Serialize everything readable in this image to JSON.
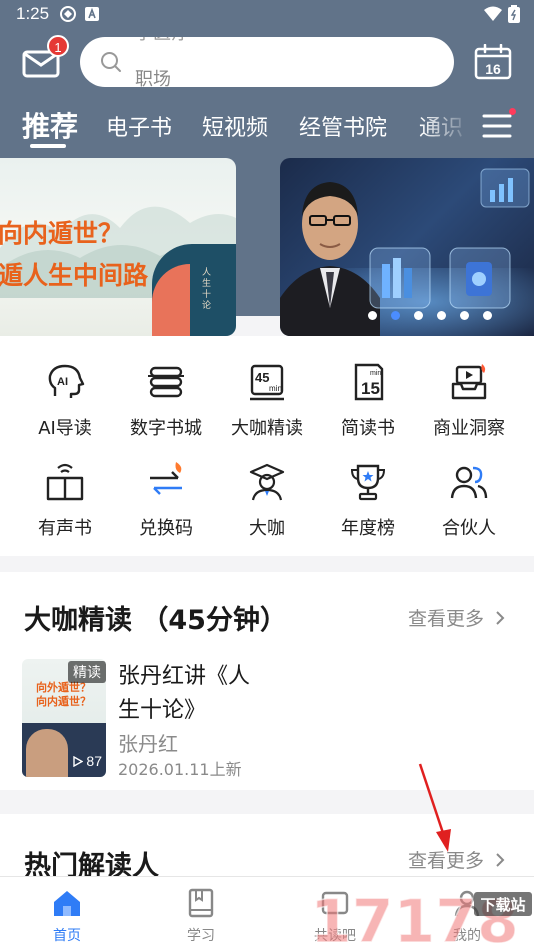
{
  "status_bar": {
    "time": "1:25"
  },
  "header": {
    "mail_badge": "1",
    "search": {
      "ghost_text": "学医疗",
      "placeholder": "职场"
    },
    "calendar_day": "16"
  },
  "tabs": [
    {
      "label": "推荐",
      "active": true
    },
    {
      "label": "电子书",
      "active": false
    },
    {
      "label": "短视频",
      "active": false
    },
    {
      "label": "经管书院",
      "active": false
    },
    {
      "label": "通识",
      "active": false
    }
  ],
  "banner": {
    "left_line1": "向内遁世？",
    "left_line2": "遁人生中间路",
    "left_book_text": "人生十论",
    "dots_count": 6,
    "active_dot": 1
  },
  "quick_menu": [
    {
      "label": "AI导读",
      "icon": "ai-head-icon"
    },
    {
      "label": "数字书城",
      "icon": "book-stack-icon"
    },
    {
      "label": "大咖精读",
      "icon": "45min-icon"
    },
    {
      "label": "简读书",
      "icon": "15min-icon"
    },
    {
      "label": "商业洞察",
      "icon": "inbox-play-icon"
    },
    {
      "label": "有声书",
      "icon": "audio-book-icon"
    },
    {
      "label": "兑换码",
      "icon": "exchange-icon"
    },
    {
      "label": "大咖",
      "icon": "graduate-icon"
    },
    {
      "label": "年度榜",
      "icon": "trophy-icon"
    },
    {
      "label": "合伙人",
      "icon": "partners-icon"
    }
  ],
  "section_experts": {
    "title": "大咖精读 （45分钟）",
    "see_more": "查看更多",
    "card": {
      "tag": "精读",
      "cover_line1": "向外遁世？",
      "cover_line2": "向内遁世？",
      "plays": "87",
      "title": "张丹红讲《人生十论》",
      "author": "张丹红",
      "date": "2026.01.11上新"
    }
  },
  "section_hot": {
    "title": "热门解读人",
    "see_more": "查看更多"
  },
  "bottom_nav": [
    {
      "label": "首页",
      "icon": "home-icon",
      "active": true
    },
    {
      "label": "学习",
      "icon": "study-icon",
      "active": false
    },
    {
      "label": "共读吧",
      "icon": "coread-icon",
      "active": false
    },
    {
      "label": "我的",
      "icon": "profile-icon",
      "active": false
    }
  ],
  "watermark": {
    "text": "17178",
    "sub": "下载站"
  },
  "colors": {
    "header_bg": "#617389",
    "accent": "#2f7cf6",
    "orange": "#e8621c",
    "badge": "#e53935"
  }
}
